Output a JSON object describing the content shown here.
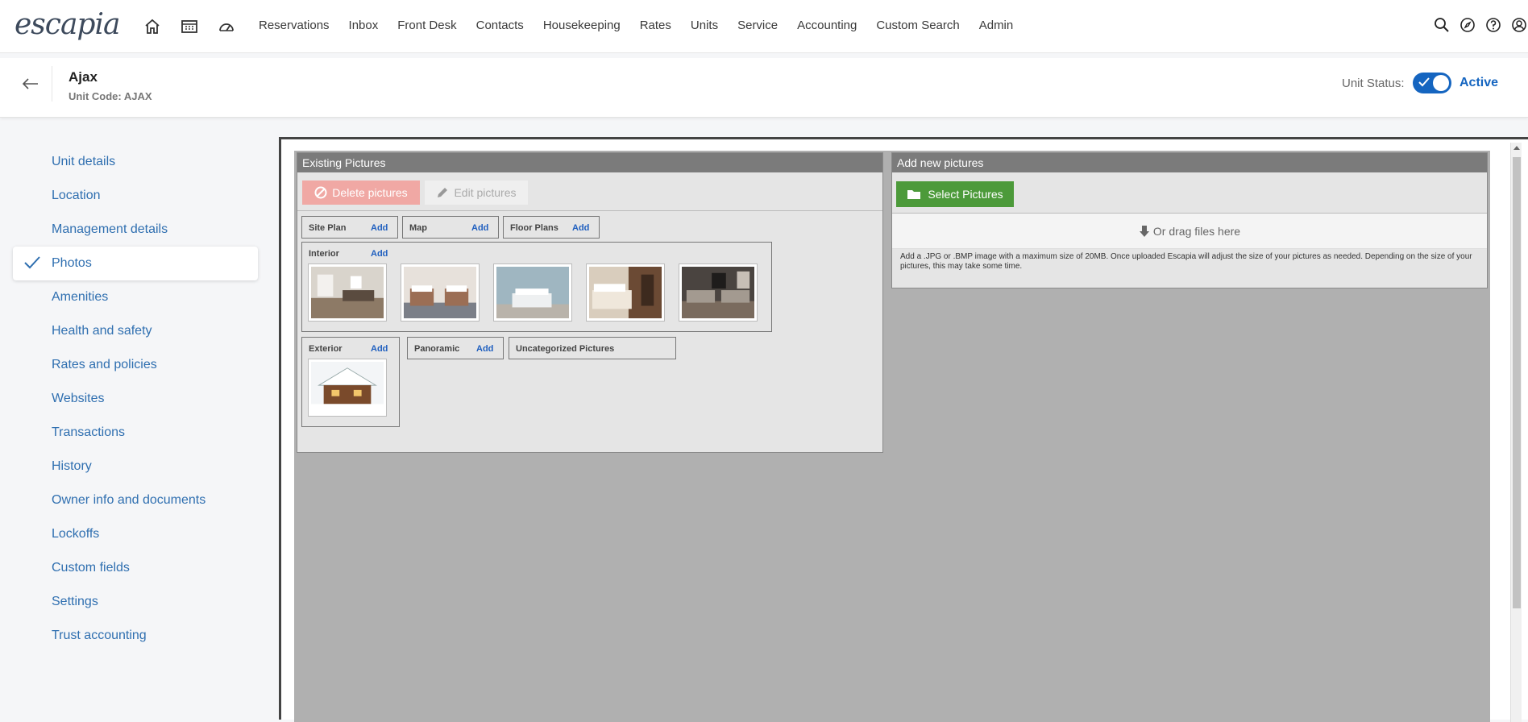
{
  "app": {
    "logo": "escapia"
  },
  "nav": {
    "icons": [
      "home-icon",
      "calendar-icon",
      "dashboard-icon"
    ],
    "links": [
      "Reservations",
      "Inbox",
      "Front Desk",
      "Contacts",
      "Housekeeping",
      "Rates",
      "Units",
      "Service",
      "Accounting",
      "Custom Search",
      "Admin"
    ],
    "right_icons": [
      "search-icon",
      "compass-icon",
      "help-icon",
      "user-icon"
    ]
  },
  "header": {
    "unit_name": "Ajax",
    "unit_code": "Unit Code: AJAX",
    "status_label": "Unit Status:",
    "status_value": "Active",
    "status_on": true
  },
  "sidebar": {
    "items": [
      {
        "label": "Unit details"
      },
      {
        "label": "Location"
      },
      {
        "label": "Management details"
      },
      {
        "label": "Photos",
        "active": true
      },
      {
        "label": "Amenities"
      },
      {
        "label": "Health and safety"
      },
      {
        "label": "Rates and policies"
      },
      {
        "label": "Websites"
      },
      {
        "label": "Transactions"
      },
      {
        "label": "History"
      },
      {
        "label": "Owner info and documents"
      },
      {
        "label": "Lockoffs"
      },
      {
        "label": "Custom fields"
      },
      {
        "label": "Settings"
      },
      {
        "label": "Trust accounting"
      }
    ]
  },
  "existing": {
    "title": "Existing Pictures",
    "delete_label": "Delete pictures",
    "edit_label": "Edit pictures",
    "add_label": "Add",
    "groups": {
      "site_plan": "Site Plan",
      "map": "Map",
      "floor_plans": "Floor Plans",
      "interior": "Interior",
      "exterior": "Exterior",
      "panoramic": "Panoramic",
      "uncategorized": "Uncategorized Pictures"
    }
  },
  "add_new": {
    "title": "Add new pictures",
    "select_label": "Select Pictures",
    "drop_label": "Or drag files here",
    "hint": "Add a .JPG or .BMP image with a maximum size of 20MB. Once uploaded Escapia will adjust the size of your pictures as needed. Depending on the size of your pictures, this may take some time."
  },
  "colors": {
    "accent": "#1565c0",
    "link": "#2f6fb0",
    "select_btn": "#4c9a3a",
    "delete_btn": "#f0a8a4"
  }
}
